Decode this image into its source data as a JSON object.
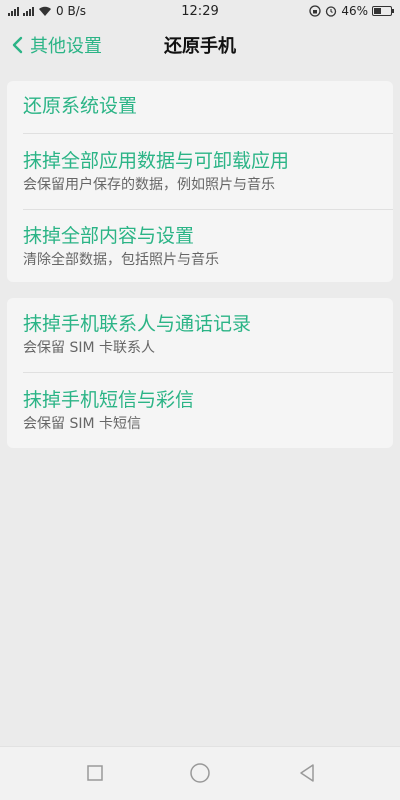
{
  "status_bar": {
    "network_speed": "0 B/s",
    "time": "12:29",
    "battery_percent": "46%",
    "battery_level": 0.46,
    "icons": [
      "signal-icon",
      "wifi-icon",
      "lock-rotation-icon",
      "alarm-icon",
      "battery-icon"
    ]
  },
  "header": {
    "back_label": "其他设置",
    "title": "还原手机"
  },
  "groups": [
    {
      "items": [
        {
          "title": "还原系统设置",
          "subtitle": ""
        },
        {
          "title": "抹掉全部应用数据与可卸载应用",
          "subtitle": "会保留用户保存的数据，例如照片与音乐"
        },
        {
          "title": "抹掉全部内容与设置",
          "subtitle": "清除全部数据，包括照片与音乐"
        }
      ]
    },
    {
      "items": [
        {
          "title": "抹掉手机联系人与通话记录",
          "subtitle": "会保留 SIM 卡联系人"
        },
        {
          "title": "抹掉手机短信与彩信",
          "subtitle": "会保留 SIM 卡短信"
        }
      ]
    }
  ],
  "colors": {
    "accent": "#2bb486",
    "background": "#ebebeb",
    "card": "#f5f5f5"
  },
  "nav_bar": {
    "icons": [
      "recent-apps-icon",
      "home-icon",
      "back-icon"
    ]
  }
}
